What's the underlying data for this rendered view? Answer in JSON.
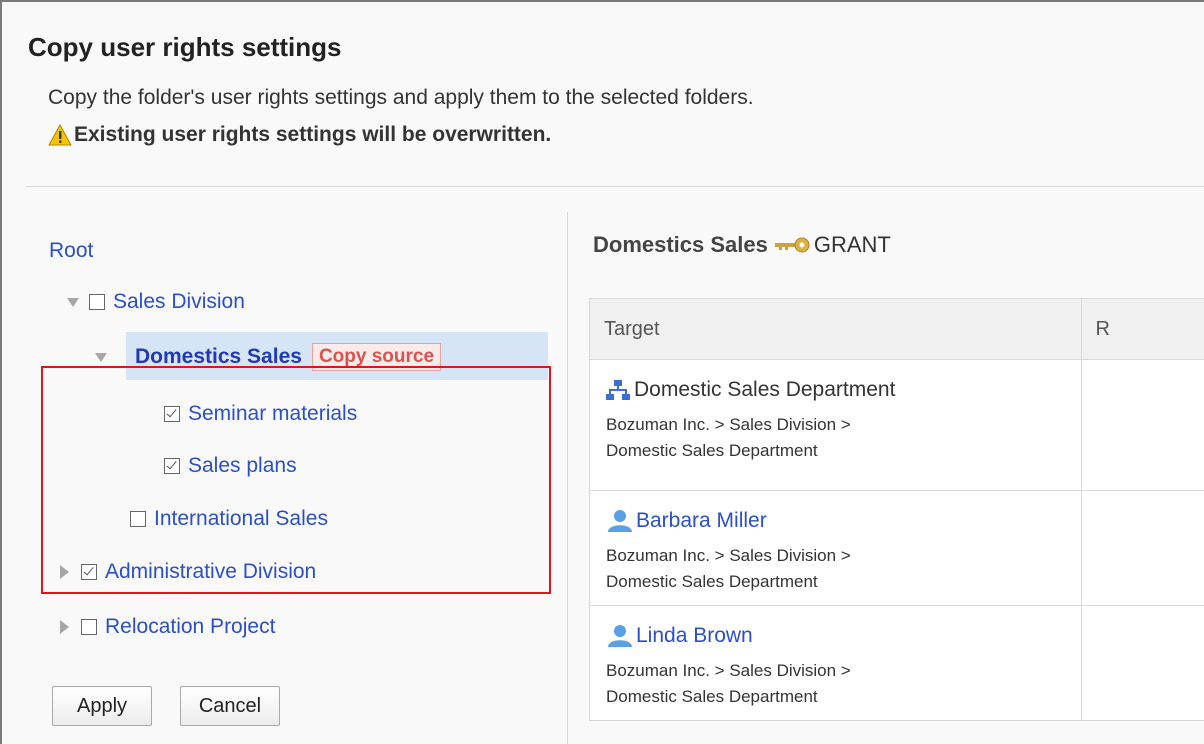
{
  "dialog": {
    "title": "Copy user rights settings",
    "description": "Copy the folder's user rights settings and apply them to the selected folders.",
    "warning": "Existing user rights settings will be overwritten."
  },
  "tree": {
    "root": "Root",
    "sales_division": "Sales Division",
    "domestics_sales": "Domestics Sales",
    "copy_source_badge": "Copy source",
    "seminar_materials": "Seminar materials",
    "sales_plans": "Sales plans",
    "international_sales": "International Sales",
    "administrative_division": "Administrative Division",
    "relocation_project": "Relocation Project",
    "checked": {
      "sales_division": false,
      "seminar_materials": true,
      "sales_plans": true,
      "international_sales": false,
      "administrative_division": true,
      "relocation_project": false
    }
  },
  "buttons": {
    "apply": "Apply",
    "cancel": "Cancel"
  },
  "panel": {
    "folder_name": "Domestics Sales",
    "grant_label": "GRANT",
    "columns": [
      "Target",
      "R"
    ],
    "rows": [
      {
        "icon": "organization-icon",
        "name": "Domestic Sales Department",
        "path_line1": "Bozuman Inc. > Sales Division >",
        "path_line2": "Domestic Sales Department"
      },
      {
        "icon": "user-icon",
        "name": "Barbara Miller",
        "path_line1": "Bozuman Inc. > Sales Division >",
        "path_line2": "Domestic Sales Department"
      },
      {
        "icon": "user-icon",
        "name": "Linda Brown",
        "path_line1": "Bozuman Inc. > Sales Division >",
        "path_line2": "Domestic Sales Department"
      }
    ]
  },
  "colors": {
    "link": "#2a4fcc",
    "highlight_box": "#e5111b",
    "selected_row": "#d6e5f5",
    "badge_text": "#d9534f"
  }
}
